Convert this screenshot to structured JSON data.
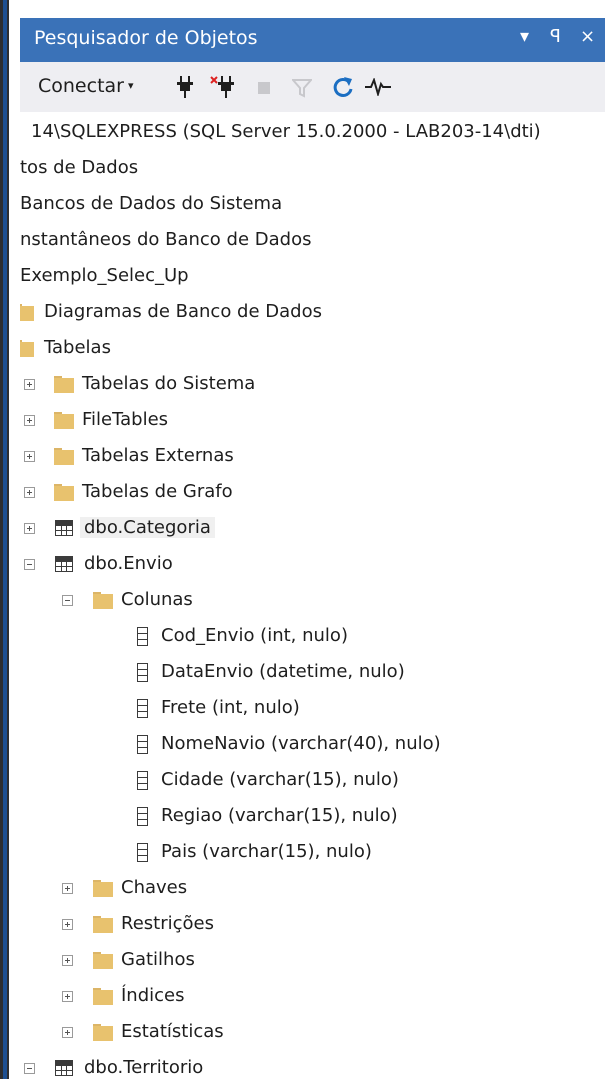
{
  "panel": {
    "title": "Pesquisador de Objetos",
    "controls": {
      "dropdown": "▾",
      "pin": "ꟼ",
      "close": "×"
    }
  },
  "toolbar": {
    "connect_label": "Conectar",
    "connect_caret": "▾",
    "icons": [
      "connect-plug-icon",
      "disconnect-icon",
      "stop-icon",
      "filter-icon",
      "refresh-icon",
      "activity-monitor-icon"
    ]
  },
  "tree": {
    "rows": [
      {
        "label": "14\\SQLEXPRESS (SQL Server 15.0.2000 - LAB203-14\\dti)"
      },
      {
        "label": "tos de Dados"
      },
      {
        "label": "Bancos de Dados do Sistema"
      },
      {
        "label": "nstantâneos do Banco de Dados"
      },
      {
        "label": "Exemplo_Selec_Up"
      },
      {
        "label": "Diagramas de Banco de Dados"
      },
      {
        "label": "Tabelas"
      },
      {
        "label": "Tabelas do Sistema"
      },
      {
        "label": "FileTables"
      },
      {
        "label": "Tabelas Externas"
      },
      {
        "label": "Tabelas de Grafo"
      },
      {
        "label": "dbo.Categoria"
      },
      {
        "label": "dbo.Envio"
      },
      {
        "label": "Colunas"
      },
      {
        "label": "Cod_Envio (int, nulo)"
      },
      {
        "label": "DataEnvio (datetime, nulo)"
      },
      {
        "label": "Frete (int, nulo)"
      },
      {
        "label": "NomeNavio (varchar(40), nulo)"
      },
      {
        "label": "Cidade (varchar(15), nulo)"
      },
      {
        "label": "Regiao (varchar(15), nulo)"
      },
      {
        "label": "Pais (varchar(15), nulo)"
      },
      {
        "label": "Chaves"
      },
      {
        "label": "Restrições"
      },
      {
        "label": "Gatilhos"
      },
      {
        "label": "Índices"
      },
      {
        "label": "Estatísticas"
      },
      {
        "label": "dbo.Territorio"
      }
    ]
  },
  "colors": {
    "titlebar": "#3a72b8",
    "toolbar": "#eeeef2",
    "folder": "#e8c26e",
    "refresh_icon": "#1b6ec2"
  }
}
